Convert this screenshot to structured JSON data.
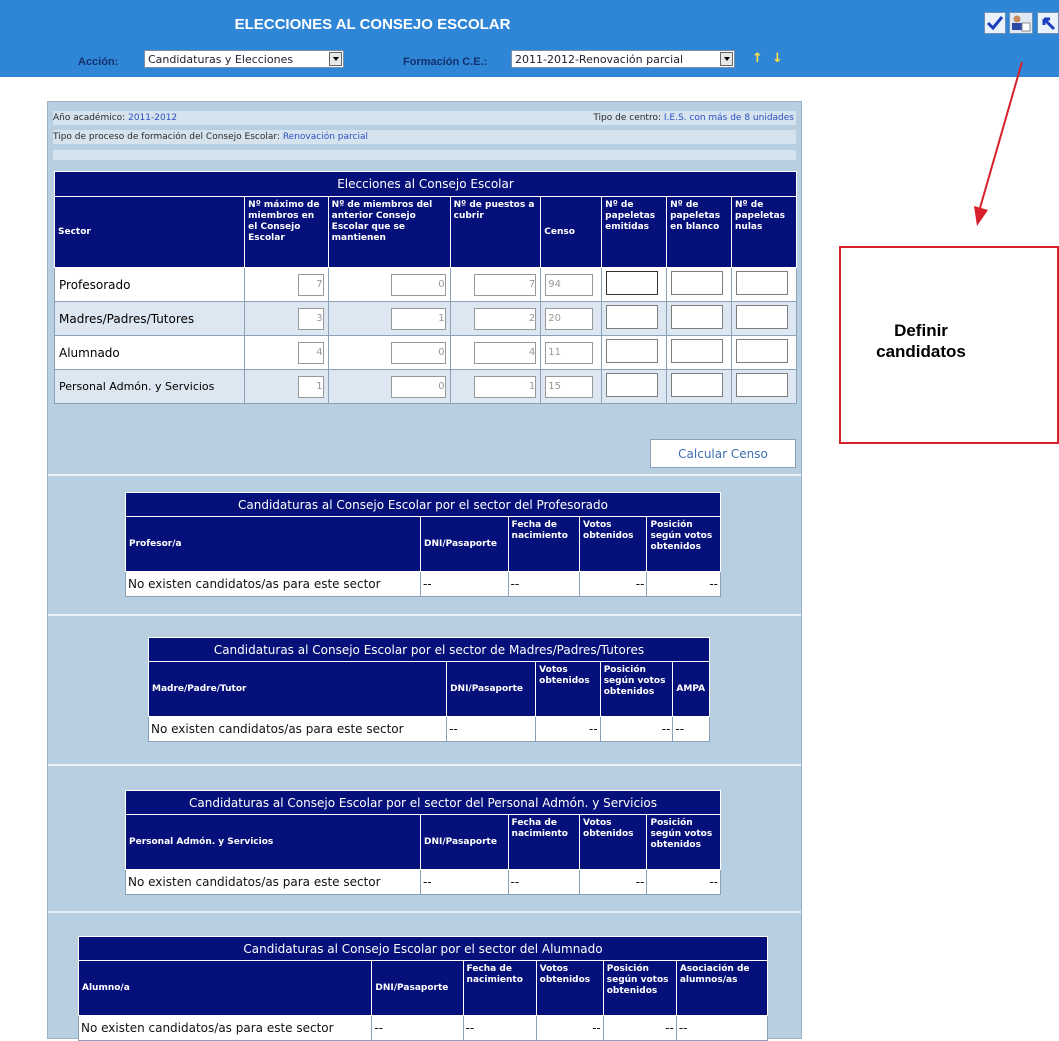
{
  "header": {
    "title": "ELECCIONES AL CONSEJO ESCOLAR"
  },
  "toolbar": {
    "accion_label": "Acción:",
    "accion_value": "Candidaturas y Elecciones",
    "formacion_label": "Formación C.E.:",
    "formacion_value": "2011-2012-Renovación parcial",
    "icons": [
      "check-icon",
      "user-card-icon",
      "back-icon"
    ]
  },
  "info": {
    "anio_label": "Año académico:",
    "anio_value": "2011-2012",
    "centro_label": "Tipo de centro:",
    "centro_value": "I.E.S. con más de 8 unidades",
    "proceso_label": "Tipo de proceso de formación del Consejo Escolar:",
    "proceso_value": "Renovación parcial"
  },
  "elecciones": {
    "caption": "Elecciones al Consejo Escolar",
    "headers": [
      "Sector",
      "Nº máximo de miembros en el Consejo Escolar",
      "Nº de miembros del anterior Consejo Escolar que se mantienen",
      "Nº de puestos a cubrir",
      "Censo",
      "Nº de papeletas emitidas",
      "Nº de papeletas en blanco",
      "Nº de papeletas nulas"
    ],
    "rows": [
      {
        "sector": "Profesorado",
        "max": "7",
        "mantienen": "0",
        "puestos": "7",
        "censo": "94"
      },
      {
        "sector": "Madres/Padres/Tutores",
        "max": "3",
        "mantienen": "1",
        "puestos": "2",
        "censo": "20"
      },
      {
        "sector": "Alumnado",
        "max": "4",
        "mantienen": "0",
        "puestos": "4",
        "censo": "11"
      },
      {
        "sector": "Personal Admón. y Servicios",
        "max": "1",
        "mantienen": "0",
        "puestos": "1",
        "censo": "15"
      }
    ]
  },
  "calc_button": "Calcular Censo",
  "candidaturas": {
    "empty_text": "No existen candidatos/as para este sector",
    "dash": "--",
    "profesorado": {
      "caption": "Candidaturas al Consejo Escolar por el sector del Profesorado",
      "headers": [
        "Profesor/a",
        "DNI/Pasaporte",
        "Fecha de nacimiento",
        "Votos obtenidos",
        "Posición según votos obtenidos"
      ]
    },
    "madres": {
      "caption": "Candidaturas al Consejo Escolar por el sector de Madres/Padres/Tutores",
      "headers": [
        "Madre/Padre/Tutor",
        "DNI/Pasaporte",
        "Votos obtenidos",
        "Posición según votos obtenidos",
        "AMPA"
      ]
    },
    "personal": {
      "caption": "Candidaturas al Consejo Escolar por el sector del Personal Admón. y Servicios",
      "headers": [
        "Personal Admón. y Servicios",
        "DNI/Pasaporte",
        "Fecha de nacimiento",
        "Votos obtenidos",
        "Posición según votos obtenidos"
      ]
    },
    "alumnado": {
      "caption": "Candidaturas al Consejo Escolar por el sector del Alumnado",
      "headers": [
        "Alumno/a",
        "DNI/Pasaporte",
        "Fecha de nacimiento",
        "Votos obtenidos",
        "Posición según votos obtenidos",
        "Asociación de alumnos/as"
      ]
    }
  },
  "callout": {
    "line1": "Definir",
    "line2": "candidatos"
  },
  "colors": {
    "bar": "#2f86d6",
    "header": "#06107a",
    "panel": "#b7cfe1",
    "callout_border": "#d6202a"
  }
}
